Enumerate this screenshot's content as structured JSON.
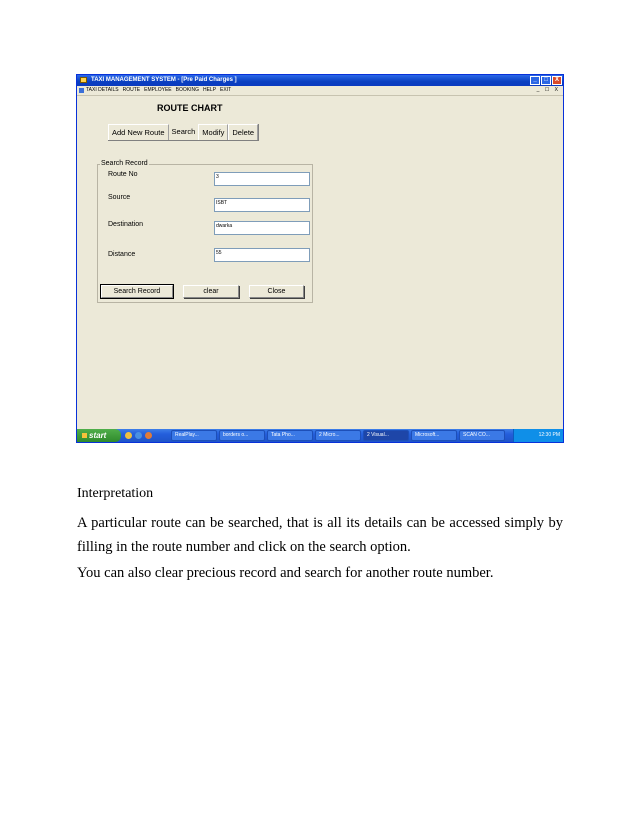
{
  "window": {
    "title": "TAXI MANAGEMENT SYSTEM - [Pre Paid Charges ]",
    "controls": [
      "_",
      "□",
      "X"
    ]
  },
  "menubar": {
    "items": [
      "TAXI DETAILS",
      "ROUTE",
      "EMPLOYEE",
      "BOOKING",
      "HELP",
      "EXIT"
    ],
    "mdi_controls": "_ ☐ X"
  },
  "form": {
    "heading": "ROUTE CHART",
    "tabs": [
      "Add New Route",
      "Search",
      "Modify",
      "Delete"
    ],
    "frame_legend": "Search Record",
    "fields": [
      {
        "label": "Route No",
        "value": "3"
      },
      {
        "label": "Source",
        "value": "ISBT"
      },
      {
        "label": "Destination",
        "value": "dwarka"
      },
      {
        "label": "Distance",
        "value": "55"
      }
    ],
    "buttons": {
      "search": "Search Record",
      "clear": "clear",
      "close": "Close"
    }
  },
  "taskbar": {
    "start": "start",
    "tasks": [
      "RealPlay...",
      "borders o...",
      "Tata Pho...",
      "2 Micro...",
      "2 Visual...",
      "Microsoft...",
      "SCAN CO..."
    ],
    "clock": "12:30 PM"
  },
  "document": {
    "subtitle": "Interpretation",
    "paragraph1": "A particular route can be searched, that is all its details can be accessed simply by filling in the route number and click on the search option.",
    "paragraph2": "You can also clear precious record and search for another route number."
  }
}
